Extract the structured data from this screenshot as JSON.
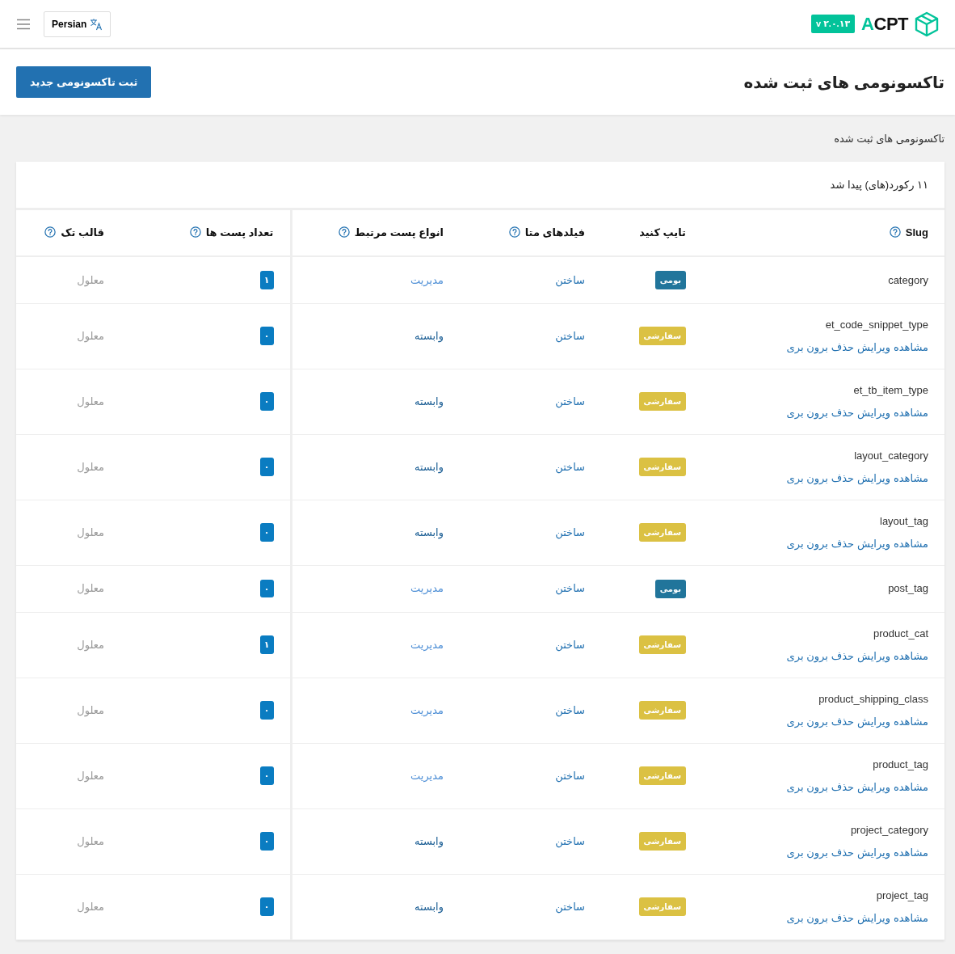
{
  "topbar": {
    "logo": "ACPT",
    "version": "v ۲.۰.۱۳",
    "language_button": "Persian"
  },
  "page_header": {
    "title": "تاکسونومی های ثبت شده",
    "new_button": "ثبت تاکسونومی جدید"
  },
  "breadcrumb": "تاکسونومی های ثبت شده",
  "card": {
    "records_found": "۱۱ رکورد(های) پیدا شد"
  },
  "table": {
    "columns": [
      {
        "label": "Slug",
        "help": true
      },
      {
        "label": "تایپ کنید",
        "help": false
      },
      {
        "label": "فیلدهای متا",
        "help": true
      },
      {
        "label": "انواع پست مرتبط",
        "help": true
      },
      {
        "label": "تعداد پست ها",
        "help": true
      },
      {
        "label": "قالب تک",
        "help": true
      }
    ],
    "rows": [
      {
        "slug": "category",
        "type": {
          "kind": "native",
          "label": "بومی"
        },
        "actions": [],
        "meta_fields": "ساختن",
        "post_types": {
          "kind": "manage",
          "label": "مدیریت"
        },
        "count": "۱",
        "template": "معلول"
      },
      {
        "slug": "et_code_snippet_type",
        "type": {
          "kind": "custom",
          "label": "سفارشی"
        },
        "actions": [
          "مشاهده",
          "ویرایش",
          "حذف",
          "برون بری"
        ],
        "meta_fields": "ساختن",
        "post_types": {
          "kind": "assoc",
          "label": "وابسته"
        },
        "count": "۰",
        "template": "معلول"
      },
      {
        "slug": "et_tb_item_type",
        "type": {
          "kind": "custom",
          "label": "سفارشی"
        },
        "actions": [
          "مشاهده",
          "ویرایش",
          "حذف",
          "برون بری"
        ],
        "meta_fields": "ساختن",
        "post_types": {
          "kind": "assoc",
          "label": "وابسته"
        },
        "count": "۰",
        "template": "معلول"
      },
      {
        "slug": "layout_category",
        "type": {
          "kind": "custom",
          "label": "سفارشی"
        },
        "actions": [
          "مشاهده",
          "ویرایش",
          "حذف",
          "برون بری"
        ],
        "meta_fields": "ساختن",
        "post_types": {
          "kind": "assoc",
          "label": "وابسته"
        },
        "count": "۰",
        "template": "معلول"
      },
      {
        "slug": "layout_tag",
        "type": {
          "kind": "custom",
          "label": "سفارشی"
        },
        "actions": [
          "مشاهده",
          "ویرایش",
          "حذف",
          "برون بری"
        ],
        "meta_fields": "ساختن",
        "post_types": {
          "kind": "assoc",
          "label": "وابسته"
        },
        "count": "۰",
        "template": "معلول"
      },
      {
        "slug": "post_tag",
        "type": {
          "kind": "native",
          "label": "بومی"
        },
        "actions": [],
        "meta_fields": "ساختن",
        "post_types": {
          "kind": "manage",
          "label": "مدیریت"
        },
        "count": "۰",
        "template": "معلول"
      },
      {
        "slug": "product_cat",
        "type": {
          "kind": "custom",
          "label": "سفارشی"
        },
        "actions": [
          "مشاهده",
          "ویرایش",
          "حذف",
          "برون بری"
        ],
        "meta_fields": "ساختن",
        "post_types": {
          "kind": "manage",
          "label": "مدیریت"
        },
        "count": "۱",
        "template": "معلول"
      },
      {
        "slug": "product_shipping_class",
        "type": {
          "kind": "custom",
          "label": "سفارشی"
        },
        "actions": [
          "مشاهده",
          "ویرایش",
          "حذف",
          "برون بری"
        ],
        "meta_fields": "ساختن",
        "post_types": {
          "kind": "manage",
          "label": "مدیریت"
        },
        "count": "۰",
        "template": "معلول"
      },
      {
        "slug": "product_tag",
        "type": {
          "kind": "custom",
          "label": "سفارشی"
        },
        "actions": [
          "مشاهده",
          "ویرایش",
          "حذف",
          "برون بری"
        ],
        "meta_fields": "ساختن",
        "post_types": {
          "kind": "manage",
          "label": "مدیریت"
        },
        "count": "۰",
        "template": "معلول"
      },
      {
        "slug": "project_category",
        "type": {
          "kind": "custom",
          "label": "سفارشی"
        },
        "actions": [
          "مشاهده",
          "ویرایش",
          "حذف",
          "برون بری"
        ],
        "meta_fields": "ساختن",
        "post_types": {
          "kind": "assoc",
          "label": "وابسته"
        },
        "count": "۰",
        "template": "معلول"
      },
      {
        "slug": "project_tag",
        "type": {
          "kind": "custom",
          "label": "سفارشی"
        },
        "actions": [
          "مشاهده",
          "ویرایش",
          "حذف",
          "برون بری"
        ],
        "meta_fields": "ساختن",
        "post_types": {
          "kind": "assoc",
          "label": "وابسته"
        },
        "count": "۰",
        "template": "معلول"
      }
    ]
  }
}
